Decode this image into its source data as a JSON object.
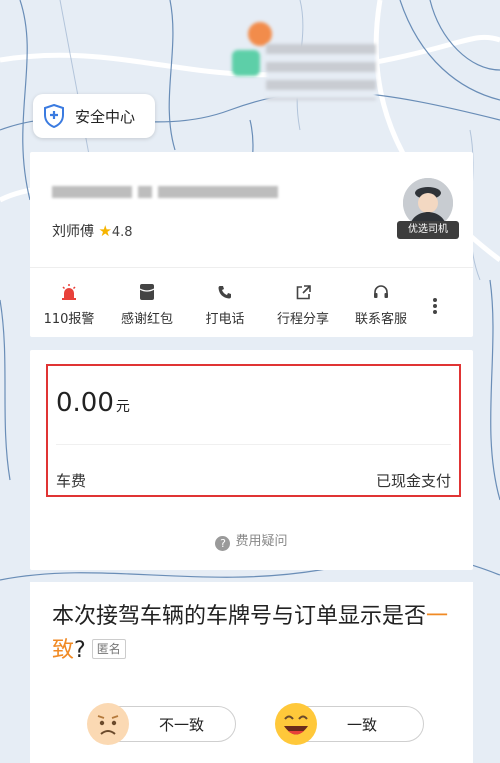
{
  "safety_center": {
    "label": "安全中心"
  },
  "driver": {
    "name": "刘师傅",
    "rating": "4.8",
    "badge": "优选司机"
  },
  "actions": [
    {
      "label": "110报警",
      "icon": "siren-icon"
    },
    {
      "label": "感谢红包",
      "icon": "red-envelope-icon"
    },
    {
      "label": "打电话",
      "icon": "phone-icon"
    },
    {
      "label": "行程分享",
      "icon": "share-icon"
    },
    {
      "label": "联系客服",
      "icon": "headset-icon"
    }
  ],
  "fee": {
    "amount": "0.00",
    "unit": "元",
    "label": "车费",
    "status": "已现金支付",
    "question": "费用疑问"
  },
  "survey": {
    "question_part1": "本次接驾车辆的车牌号与订单显示是否",
    "question_highlight": "一致",
    "question_end": "?",
    "anonymous": "匿名",
    "option_no": "不一致",
    "option_yes": "一致"
  },
  "colors": {
    "highlight": "#f08a24",
    "alarm": "#e8413a",
    "border_red": "#e03434",
    "star": "#f6b400"
  }
}
